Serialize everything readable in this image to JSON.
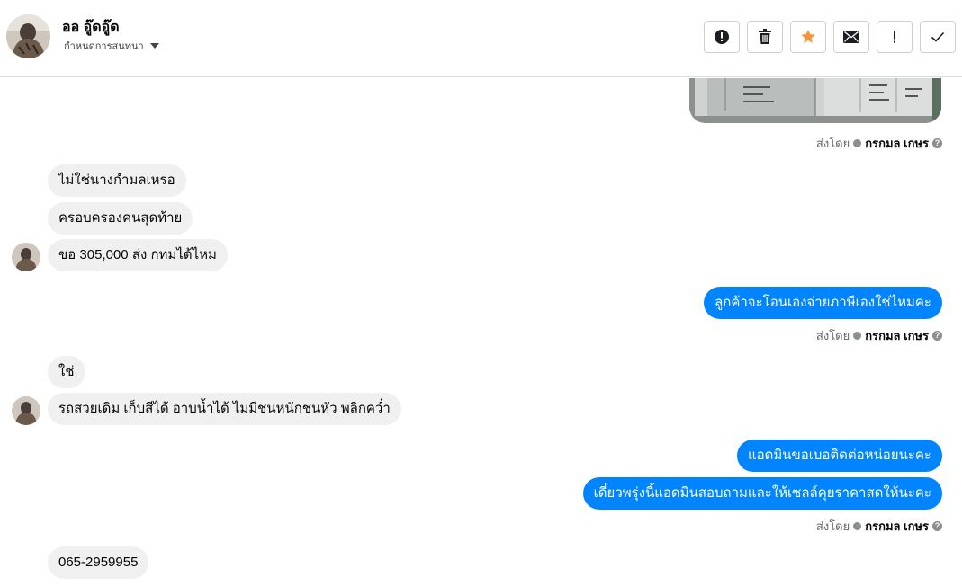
{
  "header": {
    "contact_name": "ออ อู๊ดอู๊ด",
    "conversation_settings": "กำหนดการสนทนา"
  },
  "toolbar": {
    "buttons": [
      {
        "name": "report-spam-button",
        "icon": "exclamation-circle-icon"
      },
      {
        "name": "delete-button",
        "icon": "trash-icon"
      },
      {
        "name": "star-button",
        "icon": "star-icon",
        "color": "#f7923b"
      },
      {
        "name": "mark-unread-button",
        "icon": "envelope-icon"
      },
      {
        "name": "follow-up-button",
        "icon": "exclamation-icon"
      },
      {
        "name": "mark-done-button",
        "icon": "checkmark-icon"
      }
    ]
  },
  "colors": {
    "outgoing_bubble": "#0084ff",
    "incoming_bubble": "#f0f0f0",
    "accent_star": "#f7923b"
  },
  "sent_by": {
    "prefix": "ส่งโดย",
    "name": "กรกมล เกษร"
  },
  "messages": [
    {
      "side": "in",
      "text": "ไม่ใช่นางกำมลเหรอ"
    },
    {
      "side": "in",
      "text": "ครอบครองคนสุดท้าย"
    },
    {
      "side": "in",
      "text": "ขอ 305,000 ส่ง กทมได้ไหม"
    },
    {
      "side": "out",
      "text": "ลูกค้าจะโอนเองจ่ายภาษีเองใช่ไหมคะ"
    },
    {
      "side": "in",
      "text": "ใช่"
    },
    {
      "side": "in",
      "text": "รถสวยเดิม เก็บสีได้ อาบน้ำได้ ไม่มีชนหนักชนหัว พลิกคว่ำ"
    },
    {
      "side": "out",
      "text": "แอดมินขอเบอติดต่อหน่อยนะคะ"
    },
    {
      "side": "out",
      "text": "เดี๋ยวพรุ่งนี้แอดมินสอบถามและให้เซลล์คุยราคาสดให้นะคะ"
    },
    {
      "side": "in",
      "text": "065-2959955"
    }
  ]
}
